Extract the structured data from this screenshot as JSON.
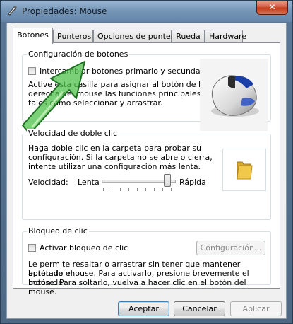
{
  "window": {
    "title": "Propiedades: Mouse",
    "close_label": "✕"
  },
  "tabs": [
    {
      "label": "Botones",
      "active": true
    },
    {
      "label": "Punteros",
      "active": false
    },
    {
      "label": "Opciones de puntero",
      "active": false
    },
    {
      "label": "Rueda",
      "active": false
    },
    {
      "label": "Hardware",
      "active": false
    }
  ],
  "button_config": {
    "legend": "Configuración de botones",
    "swap_checkbox_label": "Intercambiar botones primario y secundario",
    "swap_checked": false,
    "description_lines": [
      "Active esta casilla para asignar al botón de la",
      "derecha del mouse las funciones principales,",
      "tales como seleccionar y arrastrar."
    ]
  },
  "double_click": {
    "legend": "Velocidad de doble clic",
    "description_lines": [
      "Haga doble clic en la carpeta para probar su",
      "configuración. Si la carpeta no se abre o cierra,",
      "intente utilizar una configuración más lenta."
    ],
    "speed_label": "Velocidad:",
    "slow_label": "Lenta",
    "fast_label": "Rápida",
    "speed_value_fraction": 0.9
  },
  "click_lock": {
    "legend": "Bloqueo de clic",
    "checkbox_label": "Activar bloqueo de clic",
    "checked": false,
    "settings_button": "Configuración...",
    "description_lines": [
      "Le permite resaltar o arrastrar sin tener que mantener apretado el",
      "botón del mouse. Para activarlo, presione brevemente el botón del",
      "mouse. Para soltarlo, vuelva a hacer clic en el botón del mouse."
    ]
  },
  "footer": {
    "ok": "Aceptar",
    "cancel": "Cancelar",
    "apply": "Aplicar"
  },
  "colors": {
    "arrow_fill": "#4fc24a",
    "folder": "#f1c84a"
  }
}
